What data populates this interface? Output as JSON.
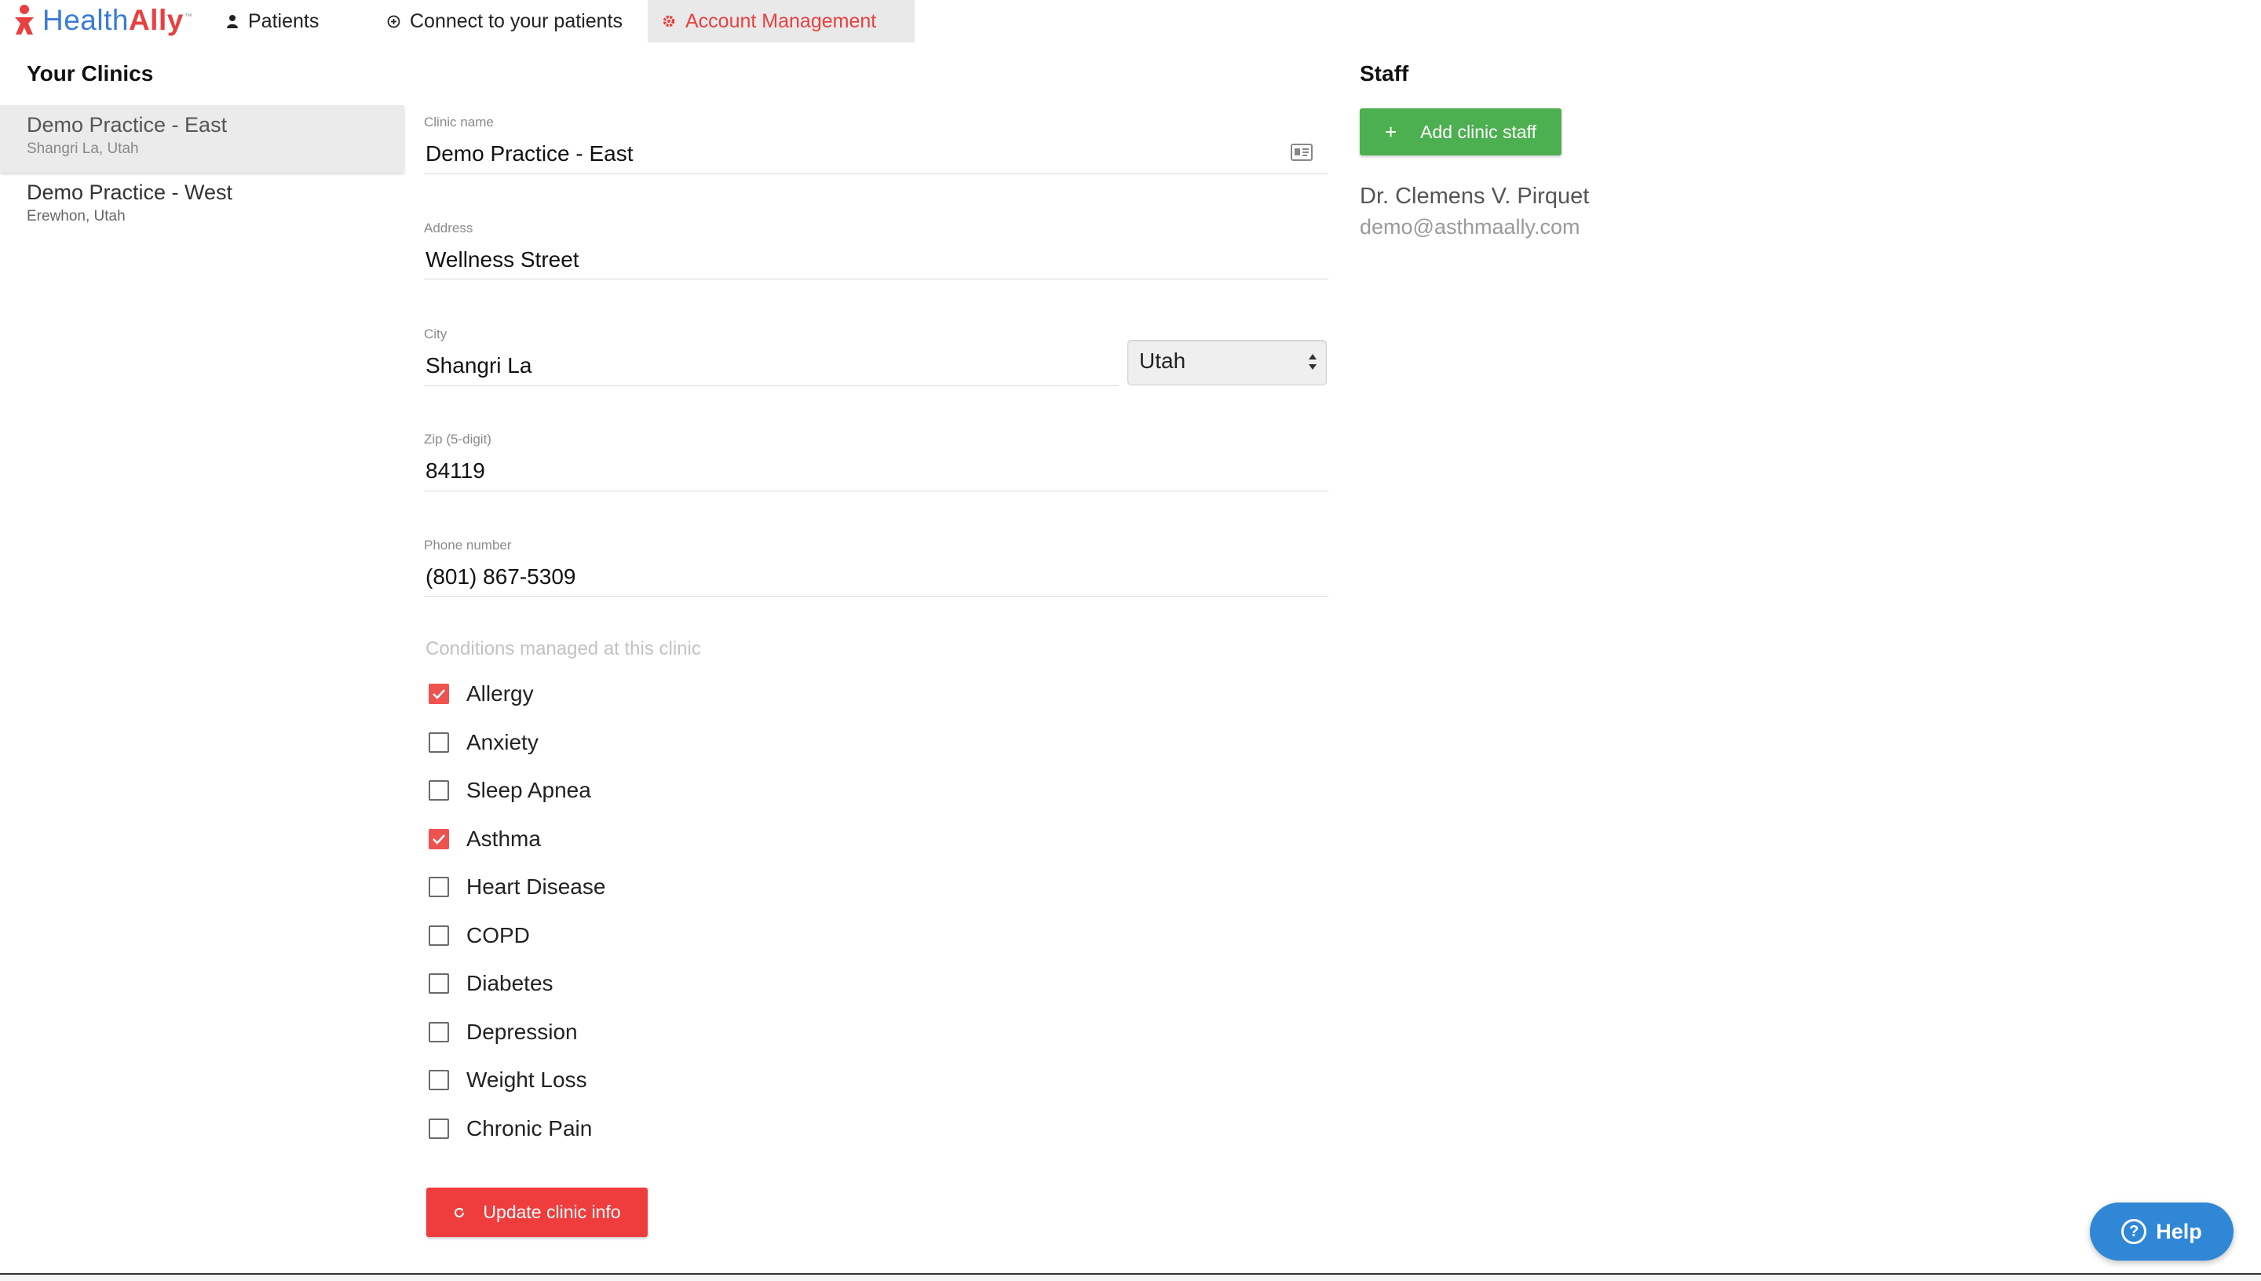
{
  "header": {
    "brand_part1": "Health",
    "brand_part2": "Ally",
    "brand_tm": "™",
    "tabs": [
      {
        "label": "Patients",
        "icon": "person-icon"
      },
      {
        "label": "Connect to your patients",
        "icon": "connect-icon"
      },
      {
        "label": "Account Management",
        "icon": "gear-icon",
        "active": true
      }
    ]
  },
  "sidebar": {
    "title": "Your Clinics",
    "clinics": [
      {
        "name": "Demo Practice - East",
        "location": "Shangri La, Utah",
        "selected": true
      },
      {
        "name": "Demo Practice - West",
        "location": "Erewhon, Utah",
        "selected": false
      }
    ]
  },
  "form": {
    "clinic_name": {
      "label": "Clinic name",
      "value": "Demo Practice - East"
    },
    "address": {
      "label": "Address",
      "value": "Wellness Street"
    },
    "city": {
      "label": "City",
      "value": "Shangri La"
    },
    "state": {
      "value": "Utah"
    },
    "zip": {
      "label": "Zip (5-digit)",
      "value": "84119"
    },
    "phone": {
      "label": "Phone number",
      "value": "(801) 867-5309"
    },
    "conditions_label": "Conditions managed at this clinic",
    "conditions": [
      {
        "label": "Allergy",
        "checked": true
      },
      {
        "label": "Anxiety",
        "checked": false
      },
      {
        "label": "Sleep Apnea",
        "checked": false
      },
      {
        "label": "Asthma",
        "checked": true
      },
      {
        "label": "Heart Disease",
        "checked": false
      },
      {
        "label": "COPD",
        "checked": false
      },
      {
        "label": "Diabetes",
        "checked": false
      },
      {
        "label": "Depression",
        "checked": false
      },
      {
        "label": "Weight Loss",
        "checked": false
      },
      {
        "label": "Chronic Pain",
        "checked": false
      }
    ],
    "update_label": "Update clinic info"
  },
  "staff": {
    "title": "Staff",
    "add_label": "Add clinic staff",
    "add_icon": "+",
    "members": [
      {
        "name": "Dr. Clemens V. Pirquet",
        "email": "demo@asthmaally.com"
      }
    ]
  },
  "help": {
    "label": "Help",
    "icon": "?"
  },
  "colors": {
    "accent_red": "#ef3d3d",
    "brand_blue": "#3a7bd5",
    "add_green": "#4caf50",
    "help_blue": "#2f87d6"
  }
}
